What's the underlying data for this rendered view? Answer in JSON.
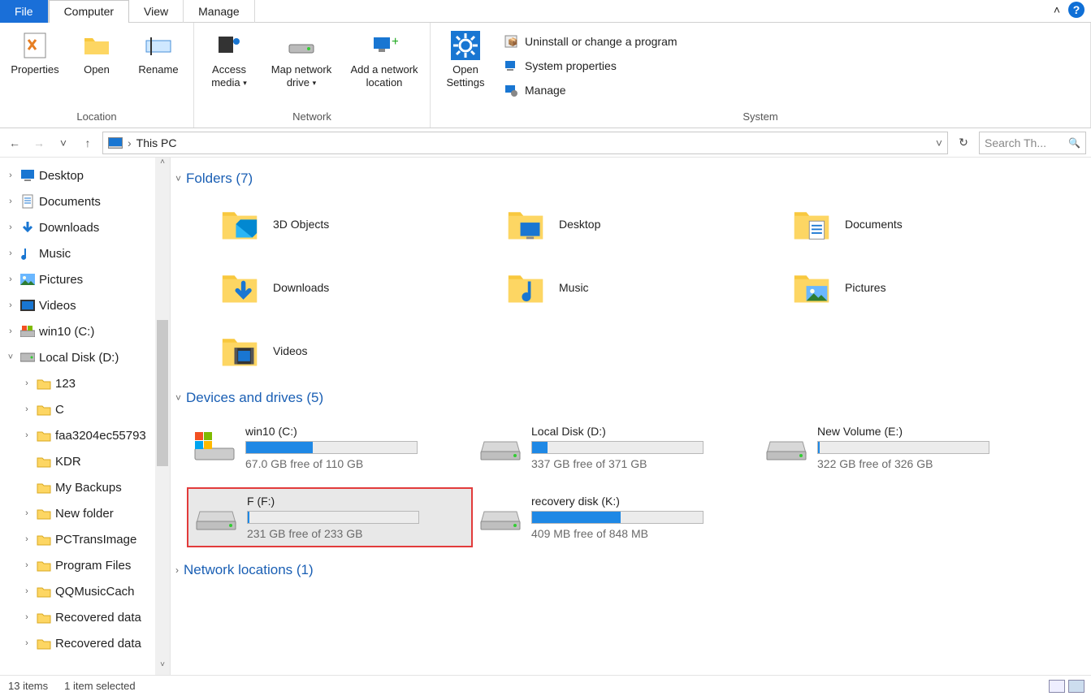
{
  "tabs": {
    "file": "File",
    "computer": "Computer",
    "view": "View",
    "manage": "Manage"
  },
  "caret_icon": "▾",
  "collapse_icon": "˄",
  "help_icon": "?",
  "ribbon": {
    "location": {
      "label": "Location",
      "properties": "Properties",
      "open": "Open",
      "rename": "Rename"
    },
    "network": {
      "label": "Network",
      "access_media": "Access media",
      "map_drive": "Map network drive",
      "add_loc": "Add a network location"
    },
    "system": {
      "label": "System",
      "open_settings": "Open Settings",
      "uninstall": "Uninstall or change a program",
      "sys_props": "System properties",
      "manage": "Manage"
    }
  },
  "addr": {
    "breadcrumb_sep": "›",
    "location": "This PC",
    "dropdown_icon": "˅",
    "refresh_icon": "↻"
  },
  "search": {
    "placeholder": "Search Th...",
    "icon": "🔍"
  },
  "nav": {
    "back": "←",
    "fwd": "→",
    "recent": "˅",
    "up": "↑"
  },
  "tree": {
    "items": [
      {
        "t": "›",
        "ico": "desktop",
        "label": "Desktop",
        "d": 0
      },
      {
        "t": "›",
        "ico": "doc",
        "label": "Documents",
        "d": 0
      },
      {
        "t": "›",
        "ico": "down",
        "label": "Downloads",
        "d": 0
      },
      {
        "t": "›",
        "ico": "music",
        "label": "Music",
        "d": 0
      },
      {
        "t": "›",
        "ico": "pic",
        "label": "Pictures",
        "d": 0
      },
      {
        "t": "›",
        "ico": "vid",
        "label": "Videos",
        "d": 0
      },
      {
        "t": "›",
        "ico": "drive-win",
        "label": "win10 (C:)",
        "d": 0
      },
      {
        "t": "˅",
        "ico": "drive",
        "label": "Local Disk (D:)",
        "d": 0
      },
      {
        "t": "›",
        "ico": "folder",
        "label": "123",
        "d": 1
      },
      {
        "t": "›",
        "ico": "folder",
        "label": "C",
        "d": 1
      },
      {
        "t": "›",
        "ico": "folder",
        "label": "faa3204ec55793",
        "d": 1
      },
      {
        "t": "",
        "ico": "folder",
        "label": "KDR",
        "d": 1
      },
      {
        "t": "",
        "ico": "folder",
        "label": "My Backups",
        "d": 1
      },
      {
        "t": "›",
        "ico": "folder",
        "label": "New folder",
        "d": 1
      },
      {
        "t": "›",
        "ico": "folder",
        "label": "PCTransImage",
        "d": 1
      },
      {
        "t": "›",
        "ico": "folder",
        "label": "Program Files",
        "d": 1
      },
      {
        "t": "›",
        "ico": "folder",
        "label": "QQMusicCach",
        "d": 1
      },
      {
        "t": "›",
        "ico": "folder",
        "label": "Recovered data",
        "d": 1
      },
      {
        "t": "›",
        "ico": "folder",
        "label": "Recovered data",
        "d": 1
      }
    ],
    "scroll_up_icon": "˄",
    "scroll_down_icon": "˅"
  },
  "sections": {
    "folders": {
      "title": "Folders (7)",
      "chev": "˅",
      "items": [
        {
          "label": "3D Objects",
          "ico": "3d"
        },
        {
          "label": "Desktop",
          "ico": "desktop"
        },
        {
          "label": "Documents",
          "ico": "doc"
        },
        {
          "label": "Downloads",
          "ico": "down"
        },
        {
          "label": "Music",
          "ico": "music"
        },
        {
          "label": "Pictures",
          "ico": "pic"
        },
        {
          "label": "Videos",
          "ico": "vid"
        }
      ]
    },
    "drives": {
      "title": "Devices and drives (5)",
      "chev": "˅",
      "items": [
        {
          "label": "win10 (C:)",
          "free": "67.0 GB free of 110 GB",
          "fill": 39,
          "ico": "win"
        },
        {
          "label": "Local Disk (D:)",
          "free": "337 GB free of 371 GB",
          "fill": 9,
          "ico": "hdd"
        },
        {
          "label": "New Volume (E:)",
          "free": "322 GB free of 326 GB",
          "fill": 1,
          "ico": "hdd"
        },
        {
          "label": "F (F:)",
          "free": "231 GB free of 233 GB",
          "fill": 1,
          "ico": "hdd",
          "selected": true
        },
        {
          "label": "recovery disk (K:)",
          "free": "409 MB free of 848 MB",
          "fill": 52,
          "ico": "hdd"
        }
      ]
    },
    "network": {
      "title": "Network locations (1)",
      "chev": "›"
    }
  },
  "status": {
    "items": "13 items",
    "selected": "1 item selected"
  }
}
